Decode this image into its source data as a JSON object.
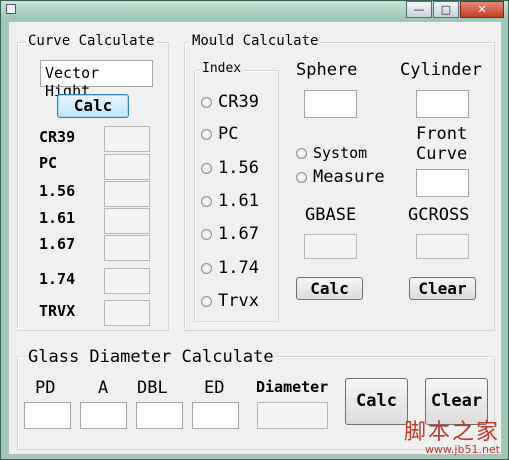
{
  "titlebar": {
    "minimize": "—",
    "maximize": "□",
    "close": "✕"
  },
  "curve": {
    "title": "Curve Calculate",
    "input_value": "Vector Hight",
    "calc_label": "Calc",
    "rows": [
      "CR39",
      "PC",
      "1.56",
      "1.61",
      "1.67",
      "1.74",
      "TRVX"
    ]
  },
  "mould": {
    "title": "Mould Calculate",
    "index_title": "Index",
    "radios": [
      "CR39",
      "PC",
      "1.56",
      "1.61",
      "1.67",
      "1.74",
      "Trvx"
    ],
    "sphere": "Sphere",
    "cylinder": "Cylinder",
    "front_curve": "Front\nCurve",
    "systom": "Systom",
    "measure": "Measure",
    "gbase": "GBASE",
    "gcross": "GCROSS",
    "calc_label": "Calc",
    "clear_label": "Clear"
  },
  "glass": {
    "title": "Glass Diameter Calculate",
    "pd": "PD",
    "a": "A",
    "dbl": "DBL",
    "ed": "ED",
    "diameter": "Diameter",
    "calc_label": "Calc",
    "clear_label": "Clear"
  },
  "watermark": {
    "line1": "脚本之家",
    "line2": "www.jb51.net"
  }
}
